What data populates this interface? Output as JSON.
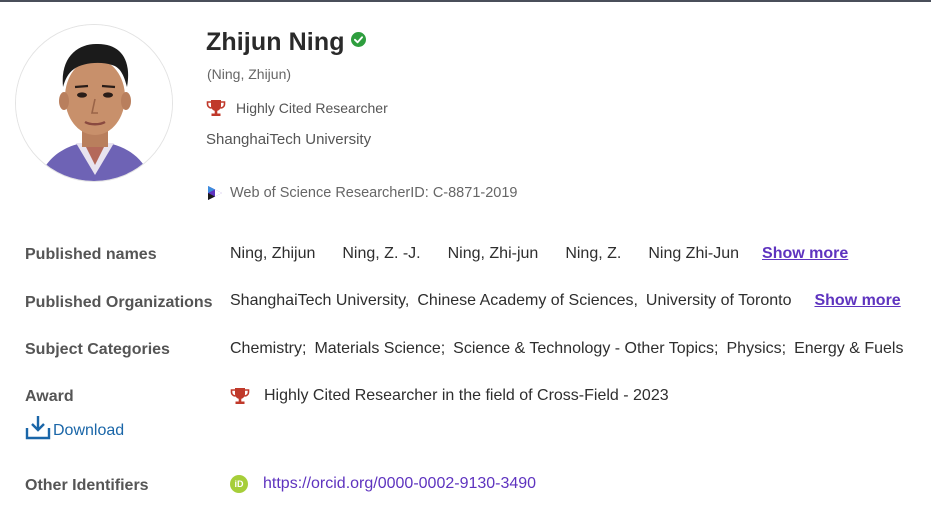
{
  "profile": {
    "name": "Zhijun Ning",
    "alt_name": "(Ning, Zhijun)",
    "badge": "Highly Cited Researcher",
    "institution": "ShanghaiTech University",
    "researcher_id": "Web of Science ResearcherID: C-8871-2019"
  },
  "details": {
    "published_names_label": "Published names",
    "published_names": [
      "Ning, Zhijun",
      "Ning, Z. -J.",
      "Ning, Zhi-jun",
      "Ning, Z.",
      "Ning Zhi-Jun"
    ],
    "published_names_more": "Show more",
    "orgs_label": "Published Organizations",
    "orgs": [
      "ShanghaiTech University,",
      "Chinese Academy of Sciences,",
      "University of Toronto"
    ],
    "orgs_more": "Show more",
    "subjects_label": "Subject Categories",
    "subjects": [
      "Chemistry;",
      "Materials Science;",
      "Science & Technology - Other Topics;",
      "Physics;",
      "Energy & Fuels"
    ],
    "award_label": "Award",
    "award_text": "Highly Cited Researcher in the field of Cross-Field - 2023",
    "download_label": "Download",
    "identifiers_label": "Other Identifiers",
    "orcid_url": "https://orcid.org/0000-0002-9130-3490"
  },
  "colors": {
    "accent_link": "#5e33bf",
    "download_blue": "#1a66a8",
    "verified_green": "#2e9e3e",
    "trophy_red": "#c0392b",
    "orcid_green": "#a6ce39"
  }
}
